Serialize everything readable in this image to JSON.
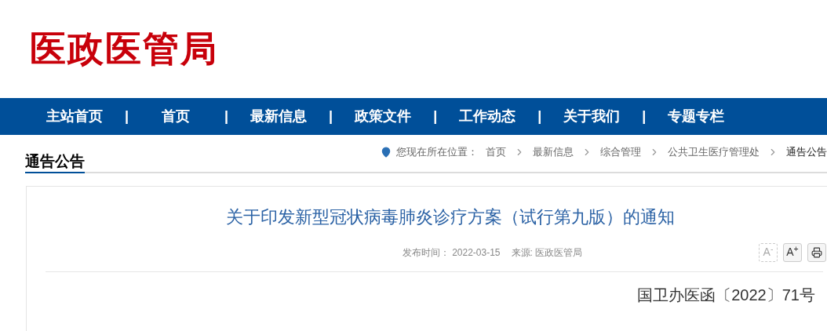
{
  "logo": "医政医管局",
  "nav": [
    {
      "label": "主站首页",
      "separator": "|"
    },
    {
      "label": "首页",
      "separator": "|"
    },
    {
      "label": "最新信息",
      "separator": "|"
    },
    {
      "label": "政策文件",
      "separator": "|"
    },
    {
      "label": "工作动态",
      "separator": "|"
    },
    {
      "label": "关于我们",
      "separator": "|"
    },
    {
      "label": "专题专栏"
    }
  ],
  "section_title": "通告公告",
  "breadcrumb": {
    "prefix": "您现在所在位置：",
    "items": [
      {
        "label": "首页",
        "current": false
      },
      {
        "label": "最新信息",
        "current": false
      },
      {
        "label": "综合管理",
        "current": false
      },
      {
        "label": "公共卫生医疗管理处",
        "current": false
      },
      {
        "label": "通告公告",
        "current": true
      }
    ]
  },
  "article": {
    "title": "关于印发新型冠状病毒肺炎诊疗方案（试行第九版）的通知",
    "meta": [
      {
        "label": "发布时间：",
        "value": "2022-03-15"
      },
      {
        "label": "来源:",
        "value": "医政医管局"
      }
    ],
    "tools": [
      {
        "kind": "font",
        "label": "A$^{-}$",
        "disabled": true
      },
      {
        "kind": "font",
        "label": "A$^{+}$",
        "disabled": false
      },
      {
        "kind": "print",
        "disabled": false
      }
    ],
    "doc_number": "国卫办医函〔2022〕71号"
  }
}
